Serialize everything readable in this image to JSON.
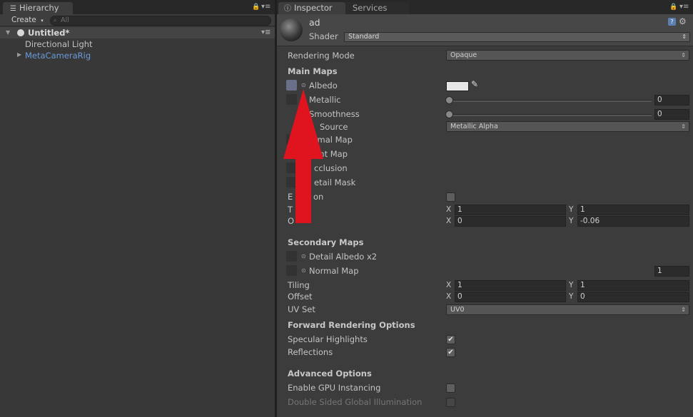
{
  "hierarchy": {
    "tab_label": "Hierarchy",
    "create_label": "Create",
    "search_placeholder": "All",
    "scene_name": "Untitled*",
    "items": [
      {
        "label": "Directional Light"
      },
      {
        "label": "MetaCameraRig"
      }
    ]
  },
  "inspector": {
    "tab_label": "Inspector",
    "services_tab_label": "Services",
    "material_name": "ad",
    "shader_label": "Shader",
    "shader_value": "Standard",
    "rendering_mode_label": "Rendering Mode",
    "rendering_mode_value": "Opaque",
    "main_maps": {
      "title": "Main Maps",
      "albedo_label": "Albedo",
      "metallic_label": "Metallic",
      "metallic_value": "0",
      "smoothness_label": "Smoothness",
      "smoothness_value": "0",
      "source_label": "Source",
      "source_value": "Metallic Alpha",
      "normal_map_label": "rmal Map",
      "height_map_label": "ght Map",
      "occlusion_label": "cclusion",
      "detail_mask_label": "etail Mask",
      "emission_label": "E",
      "emission_label_tail": "on",
      "tiling_label": "T",
      "offset_label": "O",
      "tiling_x": "1",
      "tiling_y": "1",
      "offset_x": "0",
      "offset_y": "-0.06"
    },
    "secondary_maps": {
      "title": "Secondary Maps",
      "detail_albedo_label": "Detail Albedo x2",
      "normal_map_label": "Normal Map",
      "normal_map_value": "1",
      "tiling_label": "Tiling",
      "offset_label": "Offset",
      "tiling_x": "1",
      "tiling_y": "1",
      "offset_x": "0",
      "offset_y": "0",
      "uv_set_label": "UV Set",
      "uv_set_value": "UV0"
    },
    "forward_rendering": {
      "title": "Forward Rendering Options",
      "specular_label": "Specular Highlights",
      "specular_checked": true,
      "reflections_label": "Reflections",
      "reflections_checked": true
    },
    "advanced": {
      "title": "Advanced Options",
      "gpu_instancing_label": "Enable GPU Instancing",
      "double_sided_gi_label": "Double Sided Global Illumination"
    },
    "axis_x": "X",
    "axis_y": "Y"
  },
  "colors": {
    "annotation_arrow": "#e0141e",
    "link_blue": "#6a9bdc",
    "albedo_color": "#e6e6e6"
  }
}
